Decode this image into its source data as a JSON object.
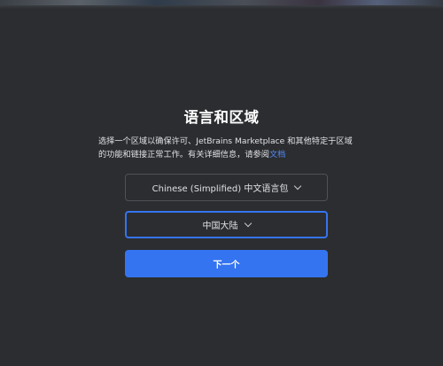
{
  "page": {
    "title": "语言和区域",
    "description_text": "选择一个区域以确保许可、JetBrains Marketplace 和其他特定于区域的功能和链接正常工作。有关详细信息，请参阅",
    "description_link": "文档"
  },
  "form": {
    "language_value": "Chinese (Simplified) 中文语言包",
    "region_value": "中国大陆",
    "next_label": "下一个"
  },
  "colors": {
    "background": "#2b2d30",
    "accent": "#3574f0",
    "link": "#548af7"
  }
}
